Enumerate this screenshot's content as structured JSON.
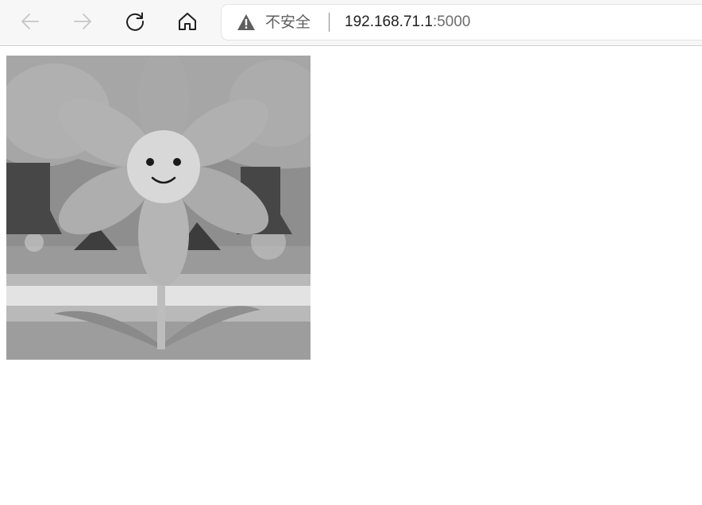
{
  "browser": {
    "security_label": "不安全",
    "url_host": "192.168.71.1",
    "url_port": ":5000",
    "icons": {
      "back": "arrow-left-icon",
      "forward": "arrow-right-icon",
      "reload": "reload-icon",
      "home": "home-icon",
      "security": "warning-triangle-icon"
    }
  },
  "page": {
    "image_subject": "smiling-flower"
  }
}
